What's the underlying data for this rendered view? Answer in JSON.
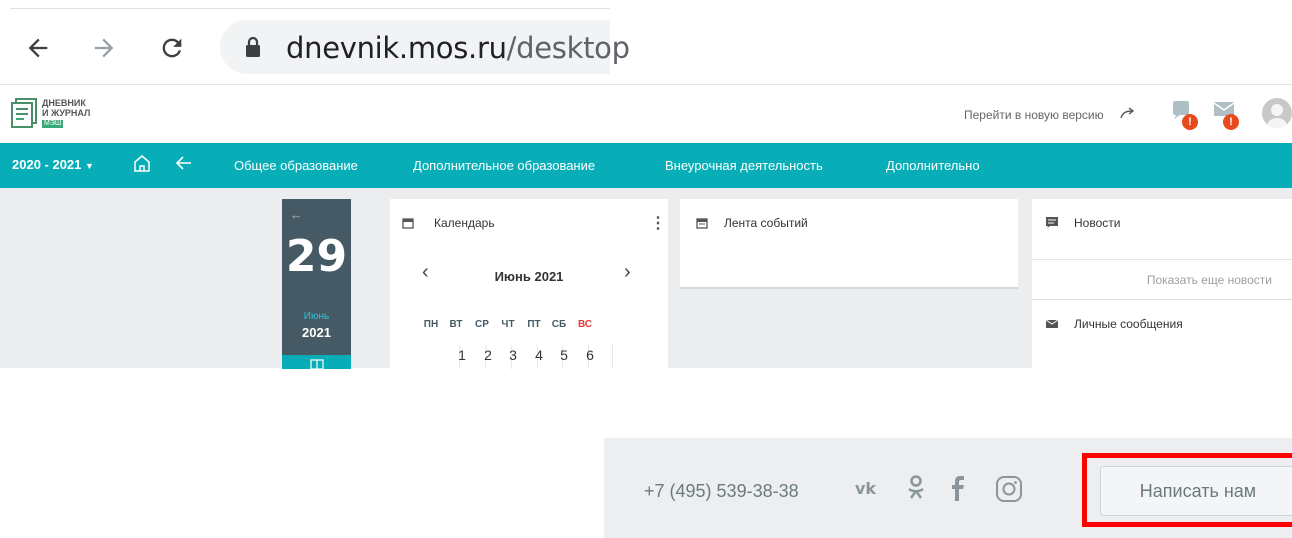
{
  "browser": {
    "url_domain": "dnevnik.mos.ru",
    "url_path": "/desktop"
  },
  "header": {
    "logo_line1": "ДНЕВНИК",
    "logo_line2": "И ЖУРНАЛ",
    "logo_badge": "МЭШ",
    "new_version_link": "Перейти в новую версию",
    "notification_badge": "!",
    "messages_badge": "!"
  },
  "nav": {
    "year_selector": "2020 - 2021",
    "items": [
      {
        "label": "Общее образование"
      },
      {
        "label": "Дополнительное образование"
      },
      {
        "label": "Внеурочная деятельность"
      },
      {
        "label": "Дополнительно"
      }
    ]
  },
  "date_card": {
    "day": "29",
    "month": "Июнь",
    "year": "2021"
  },
  "calendar": {
    "title": "Календарь",
    "month_label": "Июнь 2021",
    "weekdays": [
      "ПН",
      "ВТ",
      "СР",
      "ЧТ",
      "ПТ",
      "СБ",
      "ВС"
    ],
    "first_row": [
      "1",
      "2",
      "3",
      "4",
      "5",
      "6"
    ]
  },
  "events": {
    "title": "Лента событий"
  },
  "news": {
    "title": "Новости",
    "show_more": "Показать еще новости"
  },
  "messages": {
    "title": "Личные сообщения"
  },
  "footer": {
    "phone": "+7 (495) 539-38-38",
    "write_button": "Написать нам"
  },
  "colors": {
    "nav_teal": "#08aeb7",
    "date_card_bg": "#455a64",
    "highlight_red": "#ff0000",
    "sunday_red": "#e53935",
    "badge_orange": "#e8491d"
  }
}
